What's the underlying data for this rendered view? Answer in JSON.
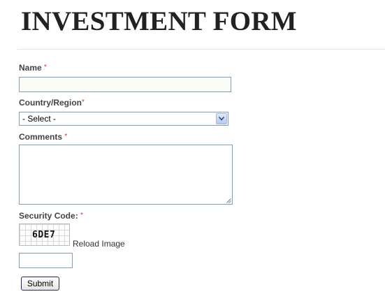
{
  "form": {
    "title": "INVESTMENT FORM",
    "required_mark": "*",
    "name": {
      "label": "Name",
      "value": ""
    },
    "country": {
      "label": "Country/Region",
      "selected": "- Select -"
    },
    "comments": {
      "label": "Comments",
      "value": ""
    },
    "security": {
      "label": "Security Code:",
      "captcha_text": "6DE7",
      "reload_label": "Reload Image",
      "value": ""
    },
    "submit_label": "Submit"
  },
  "colors": {
    "title": "#222222",
    "label": "#444444",
    "required": "#d33333",
    "input_border": "#7f9db9"
  }
}
